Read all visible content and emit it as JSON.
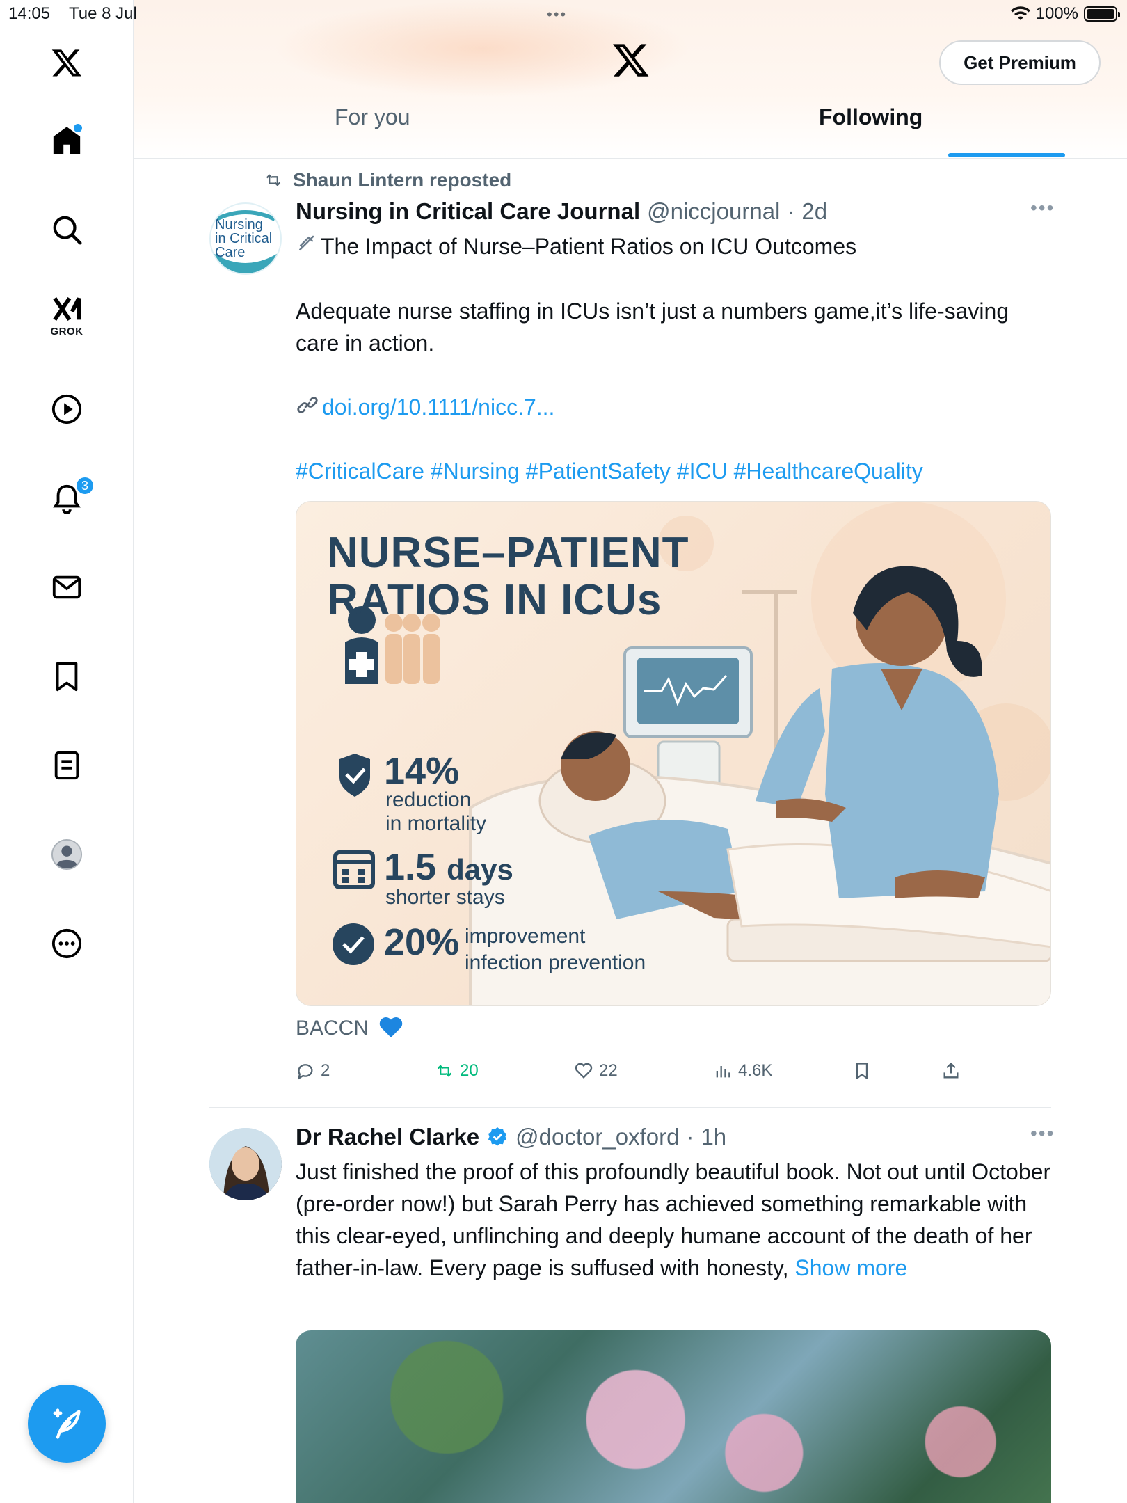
{
  "status_bar": {
    "time": "14:05",
    "date": "Tue 8 Jul",
    "battery": "100%"
  },
  "sidebar": {
    "items": [
      {
        "name": "home",
        "icon": "home-icon"
      },
      {
        "name": "search",
        "icon": "search-icon"
      },
      {
        "name": "grok",
        "icon": "grok-icon",
        "label": "GROK"
      },
      {
        "name": "video",
        "icon": "play-icon"
      },
      {
        "name": "notifications",
        "icon": "bell-icon",
        "badge": "3"
      },
      {
        "name": "messages",
        "icon": "mail-icon"
      },
      {
        "name": "bookmarks",
        "icon": "bookmark-icon"
      },
      {
        "name": "lists",
        "icon": "list-icon"
      },
      {
        "name": "profile",
        "icon": "avatar-icon"
      },
      {
        "name": "more",
        "icon": "more-icon"
      }
    ],
    "compose_icon": "compose-icon"
  },
  "header": {
    "premium_label": "Get Premium",
    "tabs": [
      {
        "label": "For you",
        "active": false
      },
      {
        "label": "Following",
        "active": true
      }
    ]
  },
  "posts": [
    {
      "repost_by": "Shaun Lintern reposted",
      "author": "Nursing in Critical Care Journal",
      "handle": "@niccjournal",
      "time": "2d",
      "avatar_text": [
        "Nursing",
        "in Critical",
        "Care"
      ],
      "headline": "The Impact of Nurse–Patient Ratios on ICU Outcomes",
      "body": "Adequate nurse staffing in ICUs isn’t just a numbers game,it’s life-saving care in action.",
      "link": "doi.org/10.1111/nicc.7...",
      "hashtags": "#CriticalCare #Nursing #PatientSafety #ICU #HealthcareQuality",
      "media": {
        "title_line1": "NURSE–PATIENT",
        "title_line2": "RATIOS IN ICUs",
        "stats": [
          {
            "value": "14%",
            "label_1": "reduction",
            "label_2": "in mortality"
          },
          {
            "value": "1.5",
            "unit": "days",
            "label_1": "shorter stays"
          },
          {
            "value": "20%",
            "label_1": "improvement",
            "label_2": "infection prevention"
          }
        ]
      },
      "footer_text": "BACCN",
      "stats": {
        "replies": "2",
        "reposts": "20",
        "likes": "22",
        "views": "4.6K"
      }
    },
    {
      "author": "Dr Rachel Clarke",
      "handle": "@doctor_oxford",
      "time": "1h",
      "verified": true,
      "body": "Just finished the proof of this profoundly beautiful book. Not out until October (pre-order now!) but Sarah Perry has achieved something remarkable with this clear-eyed, unflinching and deeply humane account of the death of her father-in-law. Every page is suffused with honesty,",
      "show_more": "Show more"
    }
  ],
  "colors": {
    "accent": "#1d9bf0",
    "repost_green": "#00ba7c",
    "text_secondary": "#536471",
    "infographic_navy": "#27455e"
  }
}
